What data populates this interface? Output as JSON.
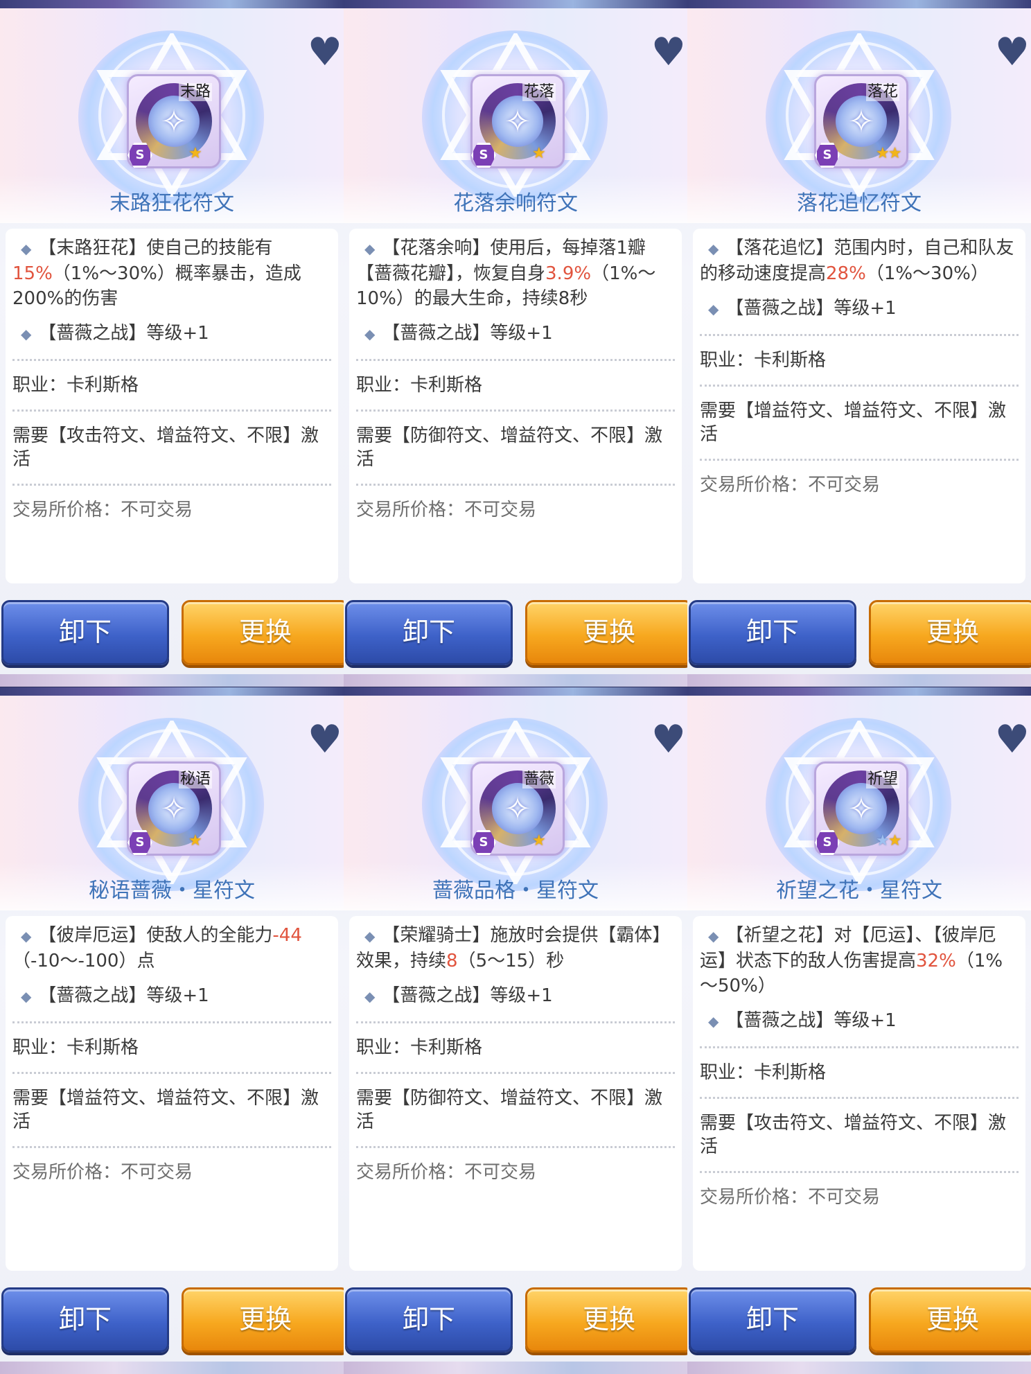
{
  "panels": [
    {
      "gem_label": "末路",
      "stars": [
        "gold"
      ],
      "title": "末路狂花符文",
      "effect_pre": "【末路狂花】使自己的技能有",
      "effect_hl": "15%",
      "effect_post": "（1%～30%）概率暴击，造成200%的伤害",
      "level": "【蔷薇之战】等级+1",
      "job": "职业：卡利斯格",
      "need": "需要【攻击符文、增益符文、不限】激活",
      "price": "交易所价格：不可交易",
      "btn_unload": "卸下",
      "btn_replace": "更换"
    },
    {
      "gem_label": "花落",
      "stars": [
        "gold"
      ],
      "title": "花落余响符文",
      "effect_pre": "【花落余响】使用后，每掉落1瓣【蔷薇花瓣】，恢复自身",
      "effect_hl": "3.9%",
      "effect_post": "（1%～10%）的最大生命，持续8秒",
      "level": "【蔷薇之战】等级+1",
      "job": "职业：卡利斯格",
      "need": "需要【防御符文、增益符文、不限】激活",
      "price": "交易所价格：不可交易",
      "btn_unload": "卸下",
      "btn_replace": "更换"
    },
    {
      "gem_label": "落花",
      "stars": [
        "gold",
        "gold"
      ],
      "title": "落花追忆符文",
      "effect_pre": "【落花追忆】范围内时，自己和队友的移动速度提高",
      "effect_hl": "28%",
      "effect_post": "（1%～30%）",
      "level": "【蔷薇之战】等级+1",
      "job": "职业：卡利斯格",
      "need": "需要【增益符文、增益符文、不限】激活",
      "price": "交易所价格：不可交易",
      "btn_unload": "卸下",
      "btn_replace": "更换"
    },
    {
      "gem_label": "秘语",
      "stars": [
        "gold"
      ],
      "title": "秘语蔷薇・星符文",
      "effect_pre": "【彼岸厄运】使敌人的全能力",
      "effect_hl": "-44",
      "effect_post": "（-10～-100）点",
      "level": "【蔷薇之战】等级+1",
      "job": "职业：卡利斯格",
      "need": "需要【增益符文、增益符文、不限】激活",
      "price": "交易所价格：不可交易",
      "btn_unload": "卸下",
      "btn_replace": "更换"
    },
    {
      "gem_label": "蔷薇",
      "stars": [
        "gold"
      ],
      "title": "蔷薇品格・星符文",
      "effect_pre": "【荣耀骑士】施放时会提供【霸体】效果，持续",
      "effect_hl": "8",
      "effect_post": "（5～15）秒",
      "level": "【蔷薇之战】等级+1",
      "job": "职业：卡利斯格",
      "need": "需要【防御符文、增益符文、不限】激活",
      "price": "交易所价格：不可交易",
      "btn_unload": "卸下",
      "btn_replace": "更换"
    },
    {
      "gem_label": "祈望",
      "stars": [
        "blue",
        "gold"
      ],
      "title": "祈望之花・星符文",
      "effect_pre": "【祈望之花】对【厄运】、【彼岸厄运】状态下的敌人伤害提高",
      "effect_hl": "32%",
      "effect_post": "（1%～50%）",
      "level": "【蔷薇之战】等级+1",
      "job": "职业：卡利斯格",
      "need": "需要【攻击符文、增益符文、不限】激活",
      "price": "交易所价格：不可交易",
      "btn_unload": "卸下",
      "btn_replace": "更换"
    }
  ],
  "icons": {
    "heart": "♥",
    "gem_glyph": "✧",
    "diamond": "◆",
    "star": "★",
    "s_badge": "S"
  },
  "colors": {
    "title": "#3f73b8",
    "highlight": "#e1543e",
    "unload_button": "#3e62c9",
    "replace_button": "#f7a81f"
  }
}
